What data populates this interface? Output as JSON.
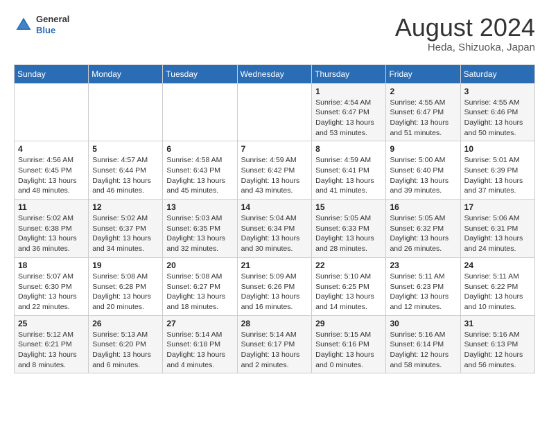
{
  "header": {
    "logo": {
      "general": "General",
      "blue": "Blue"
    },
    "title": "August 2024",
    "location": "Heda, Shizuoka, Japan"
  },
  "calendar": {
    "weekdays": [
      "Sunday",
      "Monday",
      "Tuesday",
      "Wednesday",
      "Thursday",
      "Friday",
      "Saturday"
    ],
    "weeks": [
      [
        {
          "day": "",
          "info": ""
        },
        {
          "day": "",
          "info": ""
        },
        {
          "day": "",
          "info": ""
        },
        {
          "day": "",
          "info": ""
        },
        {
          "day": "1",
          "info": "Sunrise: 4:54 AM\nSunset: 6:47 PM\nDaylight: 13 hours\nand 53 minutes."
        },
        {
          "day": "2",
          "info": "Sunrise: 4:55 AM\nSunset: 6:47 PM\nDaylight: 13 hours\nand 51 minutes."
        },
        {
          "day": "3",
          "info": "Sunrise: 4:55 AM\nSunset: 6:46 PM\nDaylight: 13 hours\nand 50 minutes."
        }
      ],
      [
        {
          "day": "4",
          "info": "Sunrise: 4:56 AM\nSunset: 6:45 PM\nDaylight: 13 hours\nand 48 minutes."
        },
        {
          "day": "5",
          "info": "Sunrise: 4:57 AM\nSunset: 6:44 PM\nDaylight: 13 hours\nand 46 minutes."
        },
        {
          "day": "6",
          "info": "Sunrise: 4:58 AM\nSunset: 6:43 PM\nDaylight: 13 hours\nand 45 minutes."
        },
        {
          "day": "7",
          "info": "Sunrise: 4:59 AM\nSunset: 6:42 PM\nDaylight: 13 hours\nand 43 minutes."
        },
        {
          "day": "8",
          "info": "Sunrise: 4:59 AM\nSunset: 6:41 PM\nDaylight: 13 hours\nand 41 minutes."
        },
        {
          "day": "9",
          "info": "Sunrise: 5:00 AM\nSunset: 6:40 PM\nDaylight: 13 hours\nand 39 minutes."
        },
        {
          "day": "10",
          "info": "Sunrise: 5:01 AM\nSunset: 6:39 PM\nDaylight: 13 hours\nand 37 minutes."
        }
      ],
      [
        {
          "day": "11",
          "info": "Sunrise: 5:02 AM\nSunset: 6:38 PM\nDaylight: 13 hours\nand 36 minutes."
        },
        {
          "day": "12",
          "info": "Sunrise: 5:02 AM\nSunset: 6:37 PM\nDaylight: 13 hours\nand 34 minutes."
        },
        {
          "day": "13",
          "info": "Sunrise: 5:03 AM\nSunset: 6:35 PM\nDaylight: 13 hours\nand 32 minutes."
        },
        {
          "day": "14",
          "info": "Sunrise: 5:04 AM\nSunset: 6:34 PM\nDaylight: 13 hours\nand 30 minutes."
        },
        {
          "day": "15",
          "info": "Sunrise: 5:05 AM\nSunset: 6:33 PM\nDaylight: 13 hours\nand 28 minutes."
        },
        {
          "day": "16",
          "info": "Sunrise: 5:05 AM\nSunset: 6:32 PM\nDaylight: 13 hours\nand 26 minutes."
        },
        {
          "day": "17",
          "info": "Sunrise: 5:06 AM\nSunset: 6:31 PM\nDaylight: 13 hours\nand 24 minutes."
        }
      ],
      [
        {
          "day": "18",
          "info": "Sunrise: 5:07 AM\nSunset: 6:30 PM\nDaylight: 13 hours\nand 22 minutes."
        },
        {
          "day": "19",
          "info": "Sunrise: 5:08 AM\nSunset: 6:28 PM\nDaylight: 13 hours\nand 20 minutes."
        },
        {
          "day": "20",
          "info": "Sunrise: 5:08 AM\nSunset: 6:27 PM\nDaylight: 13 hours\nand 18 minutes."
        },
        {
          "day": "21",
          "info": "Sunrise: 5:09 AM\nSunset: 6:26 PM\nDaylight: 13 hours\nand 16 minutes."
        },
        {
          "day": "22",
          "info": "Sunrise: 5:10 AM\nSunset: 6:25 PM\nDaylight: 13 hours\nand 14 minutes."
        },
        {
          "day": "23",
          "info": "Sunrise: 5:11 AM\nSunset: 6:23 PM\nDaylight: 13 hours\nand 12 minutes."
        },
        {
          "day": "24",
          "info": "Sunrise: 5:11 AM\nSunset: 6:22 PM\nDaylight: 13 hours\nand 10 minutes."
        }
      ],
      [
        {
          "day": "25",
          "info": "Sunrise: 5:12 AM\nSunset: 6:21 PM\nDaylight: 13 hours\nand 8 minutes."
        },
        {
          "day": "26",
          "info": "Sunrise: 5:13 AM\nSunset: 6:20 PM\nDaylight: 13 hours\nand 6 minutes."
        },
        {
          "day": "27",
          "info": "Sunrise: 5:14 AM\nSunset: 6:18 PM\nDaylight: 13 hours\nand 4 minutes."
        },
        {
          "day": "28",
          "info": "Sunrise: 5:14 AM\nSunset: 6:17 PM\nDaylight: 13 hours\nand 2 minutes."
        },
        {
          "day": "29",
          "info": "Sunrise: 5:15 AM\nSunset: 6:16 PM\nDaylight: 13 hours\nand 0 minutes."
        },
        {
          "day": "30",
          "info": "Sunrise: 5:16 AM\nSunset: 6:14 PM\nDaylight: 12 hours\nand 58 minutes."
        },
        {
          "day": "31",
          "info": "Sunrise: 5:16 AM\nSunset: 6:13 PM\nDaylight: 12 hours\nand 56 minutes."
        }
      ]
    ]
  }
}
